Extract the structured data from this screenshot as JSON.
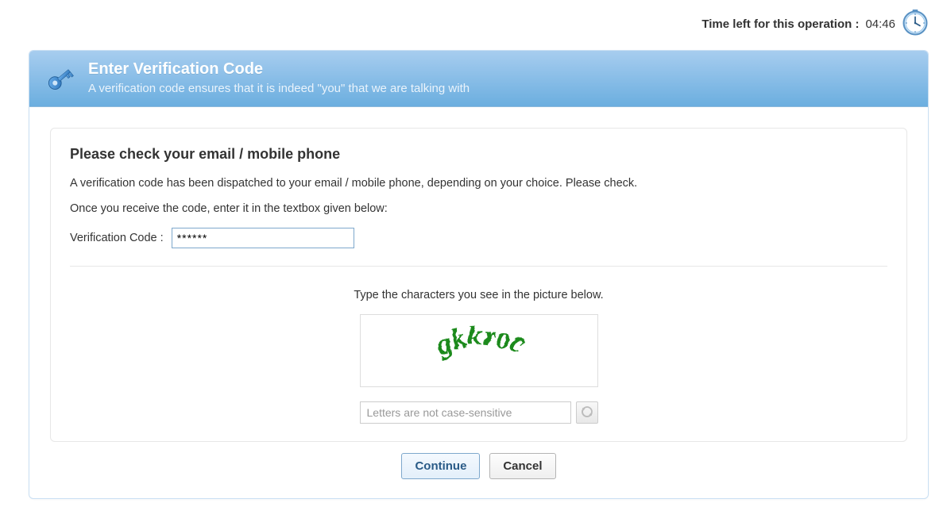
{
  "timer": {
    "label": "Time left for this operation :",
    "value": "04:46"
  },
  "header": {
    "title": "Enter Verification Code",
    "subtitle": "A verification code ensures that it is indeed \"you\" that we are talking with"
  },
  "card": {
    "heading": "Please check your email / mobile phone",
    "dispatched_text": "A verification code has been dispatched to your email / mobile phone, depending on your choice. Please check.",
    "receive_text": "Once you receive the code, enter it in the textbox given below:",
    "code_label": "Verification Code :",
    "code_value": "******"
  },
  "captcha": {
    "instruction": "Type the characters you see in the picture below.",
    "image_text": "gkkroc",
    "placeholder": "Letters are not case-sensitive"
  },
  "buttons": {
    "continue": "Continue",
    "cancel": "Cancel"
  }
}
